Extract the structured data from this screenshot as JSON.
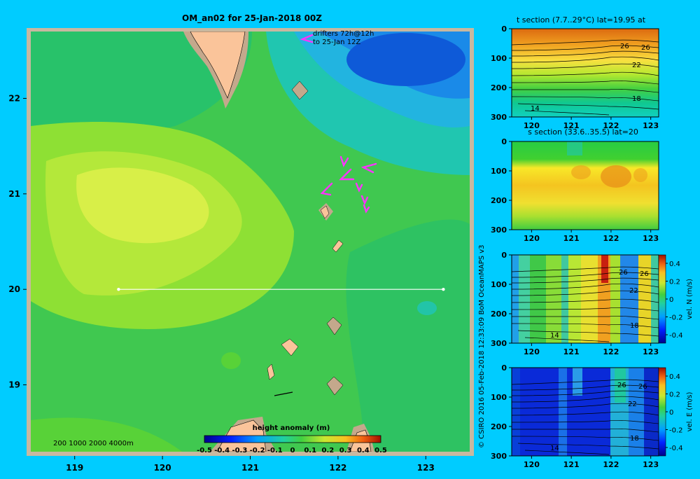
{
  "page": {
    "background": "#00ccff",
    "credit": "© CSIRO 2016   05-Feb-2018 12:33:09 BoM OceanMAPS v3"
  },
  "map": {
    "title": "OM_an02 for 25-Jan-2018 00Z",
    "x_ticks": [
      "119",
      "120",
      "121",
      "122",
      "123"
    ],
    "y_ticks": [
      "19",
      "20",
      "21",
      "22"
    ],
    "xlim": [
      118.5,
      123.5
    ],
    "ylim": [
      18.3,
      22.7
    ],
    "section_line": {
      "lat": 20,
      "lon_start": 119.5,
      "lon_end": 123.2
    },
    "drifter_note": [
      "drifters 72h@12h",
      "to 25-Jan 12Z"
    ],
    "depth_legend": "200  1000  2000  4000m",
    "colorbar_label": "height anomaly  (m)",
    "colorbar_ticks": [
      "-0.5",
      "-0.4",
      "-0.3",
      "-0.2",
      "-0.1",
      "0",
      "0.1",
      "0.2",
      "0.3",
      "0.4",
      "0.5"
    ],
    "colors": {
      "land": "#fac49a",
      "shelf": "#c4a88c",
      "drifter": "#ff33ff",
      "frame": "#c8b8a0"
    }
  },
  "sections": [
    {
      "id": "t-section",
      "title": "t section (7.7..29°C) lat=19.95 at",
      "x_ticks": [
        "120",
        "121",
        "122",
        "123"
      ],
      "y_ticks": [
        "0",
        "100",
        "200",
        "300"
      ],
      "contour_labels": [
        "26",
        "26",
        "22",
        "18",
        "14"
      ]
    },
    {
      "id": "s-section",
      "title": "s section (33.6..35.5) lat=20",
      "x_ticks": [
        "120",
        "121",
        "122",
        "123"
      ],
      "y_ticks": [
        "0",
        "100",
        "200",
        "300"
      ],
      "contour_labels": []
    },
    {
      "id": "vn-section",
      "title": "",
      "x_ticks": [
        "120",
        "121",
        "122",
        "123"
      ],
      "y_ticks": [
        "0",
        "100",
        "200",
        "300"
      ],
      "contour_labels": [
        "26",
        "26",
        "22",
        "18",
        "14"
      ],
      "colorbar_label": "vel. N (m/s)",
      "colorbar_ticks": [
        "0.4",
        "0.2",
        "0",
        "-0.2",
        "-0.4"
      ]
    },
    {
      "id": "ve-section",
      "title": "",
      "x_ticks": [
        "120",
        "121",
        "122",
        "123"
      ],
      "y_ticks": [
        "0",
        "100",
        "200",
        "300"
      ],
      "contour_labels": [
        "26",
        "26",
        "22",
        "18",
        "14"
      ],
      "colorbar_label": "vel. E (m/s)",
      "colorbar_ticks": [
        "0.4",
        "0.2",
        "0",
        "-0.2",
        "-0.4"
      ]
    }
  ],
  "chart_data": [
    {
      "type": "heatmap",
      "title": "OM_an02 for 25-Jan-2018 00Z",
      "variable": "height anomaly (m)",
      "xlim": [
        118.5,
        123.5
      ],
      "ylim": [
        18.3,
        22.7
      ],
      "color_range": [
        -0.5,
        0.5
      ],
      "features": [
        {
          "name": "positive anomaly max",
          "lon": 119.8,
          "lat": 20.9,
          "value": 0.2
        },
        {
          "name": "negative anomaly",
          "lon": 122.9,
          "lat": 22.4,
          "value": -0.15
        }
      ]
    },
    {
      "type": "heatmap",
      "title": "t section (7.7..29°C) lat=19.95 at",
      "xlim": [
        119.5,
        123.2
      ],
      "ylim": [
        300,
        0
      ]
    },
    {
      "type": "heatmap",
      "title": "s section (33.6..35.5) lat=20",
      "xlim": [
        119.5,
        123.2
      ],
      "ylim": [
        300,
        0
      ]
    },
    {
      "type": "heatmap",
      "variable": "vel. N (m/s)",
      "xlim": [
        119.5,
        123.2
      ],
      "ylim": [
        300,
        0
      ],
      "color_range": [
        -0.4,
        0.4
      ]
    },
    {
      "type": "heatmap",
      "variable": "vel. E (m/s)",
      "xlim": [
        119.5,
        123.2
      ],
      "ylim": [
        300,
        0
      ],
      "color_range": [
        -0.4,
        0.4
      ]
    }
  ]
}
